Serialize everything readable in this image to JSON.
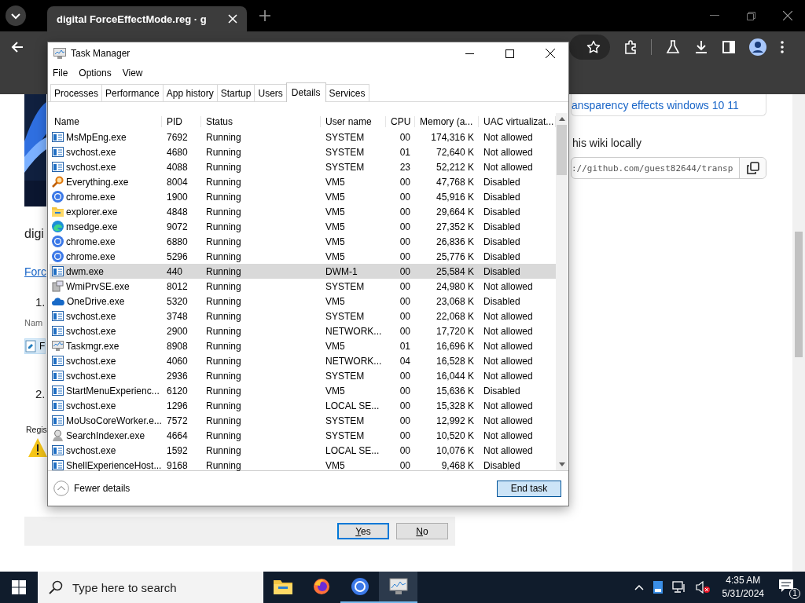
{
  "browser": {
    "tab": {
      "title": "digital ForceEffectMode.reg · g"
    }
  },
  "page": {
    "heading_fragment": "digi",
    "link_fragment": "Forc",
    "step_1": "1.",
    "name_label_fragment": "Nam",
    "file_fragment": "F",
    "step_2": "2.",
    "registry_fragment": "Regis",
    "card_link": "ansparency effects windows 10 11",
    "clone_heading": "his wiki locally",
    "clone_url": "://github.com/guest82644/transp",
    "dialog": {
      "buttons": [
        {
          "label": "Yes",
          "selected": true
        },
        {
          "label": "No",
          "selected": false
        }
      ]
    }
  },
  "task_manager": {
    "title": "Task Manager",
    "menu": [
      "File",
      "Options",
      "View"
    ],
    "tabs": [
      {
        "label": "Processes",
        "selected": false
      },
      {
        "label": "Performance",
        "selected": false
      },
      {
        "label": "App history",
        "selected": false
      },
      {
        "label": "Startup",
        "selected": false
      },
      {
        "label": "Users",
        "selected": false
      },
      {
        "label": "Details",
        "selected": true
      },
      {
        "label": "Services",
        "selected": false
      }
    ],
    "columns": [
      "Name",
      "PID",
      "Status",
      "User name",
      "CPU",
      "Memory (a...",
      "UAC virtualizat..."
    ],
    "rows": [
      {
        "kind": "service",
        "name": "MsMpEng.exe",
        "pid": "7692",
        "status": "Running",
        "user": "SYSTEM",
        "cpu": "00",
        "memory": "174,316 K",
        "uac": "Not allowed",
        "selected": false
      },
      {
        "kind": "service",
        "name": "svchost.exe",
        "pid": "4680",
        "status": "Running",
        "user": "SYSTEM",
        "cpu": "01",
        "memory": "72,640 K",
        "uac": "Not allowed",
        "selected": false
      },
      {
        "kind": "service",
        "name": "svchost.exe",
        "pid": "4088",
        "status": "Running",
        "user": "SYSTEM",
        "cpu": "23",
        "memory": "52,212 K",
        "uac": "Not allowed",
        "selected": false
      },
      {
        "kind": "search",
        "name": "Everything.exe",
        "pid": "8004",
        "status": "Running",
        "user": "VM5",
        "cpu": "00",
        "memory": "47,768 K",
        "uac": "Disabled",
        "selected": false
      },
      {
        "kind": "chrome",
        "name": "chrome.exe",
        "pid": "1900",
        "status": "Running",
        "user": "VM5",
        "cpu": "00",
        "memory": "45,916 K",
        "uac": "Disabled",
        "selected": false
      },
      {
        "kind": "folder",
        "name": "explorer.exe",
        "pid": "4848",
        "status": "Running",
        "user": "VM5",
        "cpu": "00",
        "memory": "29,664 K",
        "uac": "Disabled",
        "selected": false
      },
      {
        "kind": "edge",
        "name": "msedge.exe",
        "pid": "9072",
        "status": "Running",
        "user": "VM5",
        "cpu": "00",
        "memory": "27,352 K",
        "uac": "Disabled",
        "selected": false
      },
      {
        "kind": "chrome",
        "name": "chrome.exe",
        "pid": "6880",
        "status": "Running",
        "user": "VM5",
        "cpu": "00",
        "memory": "26,836 K",
        "uac": "Disabled",
        "selected": false
      },
      {
        "kind": "chrome",
        "name": "chrome.exe",
        "pid": "5296",
        "status": "Running",
        "user": "VM5",
        "cpu": "00",
        "memory": "25,776 K",
        "uac": "Disabled",
        "selected": false
      },
      {
        "kind": "service",
        "name": "dwm.exe",
        "pid": "440",
        "status": "Running",
        "user": "DWM-1",
        "cpu": "00",
        "memory": "25,584 K",
        "uac": "Disabled",
        "selected": true
      },
      {
        "kind": "computer",
        "name": "WmiPrvSE.exe",
        "pid": "8012",
        "status": "Running",
        "user": "SYSTEM",
        "cpu": "00",
        "memory": "24,980 K",
        "uac": "Not allowed",
        "selected": false
      },
      {
        "kind": "cloud",
        "name": "OneDrive.exe",
        "pid": "5320",
        "status": "Running",
        "user": "VM5",
        "cpu": "00",
        "memory": "23,068 K",
        "uac": "Disabled",
        "selected": false
      },
      {
        "kind": "service",
        "name": "svchost.exe",
        "pid": "3748",
        "status": "Running",
        "user": "SYSTEM",
        "cpu": "00",
        "memory": "22,068 K",
        "uac": "Not allowed",
        "selected": false
      },
      {
        "kind": "service",
        "name": "svchost.exe",
        "pid": "2900",
        "status": "Running",
        "user": "NETWORK...",
        "cpu": "00",
        "memory": "17,720 K",
        "uac": "Not allowed",
        "selected": false
      },
      {
        "kind": "monitor",
        "name": "Taskmgr.exe",
        "pid": "8908",
        "status": "Running",
        "user": "VM5",
        "cpu": "01",
        "memory": "16,696 K",
        "uac": "Not allowed",
        "selected": false
      },
      {
        "kind": "service",
        "name": "svchost.exe",
        "pid": "4060",
        "status": "Running",
        "user": "NETWORK...",
        "cpu": "04",
        "memory": "16,528 K",
        "uac": "Not allowed",
        "selected": false
      },
      {
        "kind": "service",
        "name": "svchost.exe",
        "pid": "2936",
        "status": "Running",
        "user": "SYSTEM",
        "cpu": "00",
        "memory": "16,044 K",
        "uac": "Not allowed",
        "selected": false
      },
      {
        "kind": "service",
        "name": "StartMenuExperienc...",
        "pid": "6120",
        "status": "Running",
        "user": "VM5",
        "cpu": "00",
        "memory": "15,636 K",
        "uac": "Disabled",
        "selected": false
      },
      {
        "kind": "service",
        "name": "svchost.exe",
        "pid": "1296",
        "status": "Running",
        "user": "LOCAL SE...",
        "cpu": "00",
        "memory": "15,328 K",
        "uac": "Not allowed",
        "selected": false
      },
      {
        "kind": "service",
        "name": "MoUsoCoreWorker.e...",
        "pid": "7572",
        "status": "Running",
        "user": "SYSTEM",
        "cpu": "00",
        "memory": "12,992 K",
        "uac": "Not allowed",
        "selected": false
      },
      {
        "kind": "indexer",
        "name": "SearchIndexer.exe",
        "pid": "4664",
        "status": "Running",
        "user": "SYSTEM",
        "cpu": "00",
        "memory": "10,520 K",
        "uac": "Not allowed",
        "selected": false
      },
      {
        "kind": "service",
        "name": "svchost.exe",
        "pid": "1592",
        "status": "Running",
        "user": "LOCAL SE...",
        "cpu": "00",
        "memory": "10,076 K",
        "uac": "Not allowed",
        "selected": false
      },
      {
        "kind": "service",
        "name": "ShellExperienceHost...",
        "pid": "9168",
        "status": "Running",
        "user": "VM5",
        "cpu": "00",
        "memory": "9,468 K",
        "uac": "Disabled",
        "selected": false
      }
    ],
    "footer": {
      "toggle": "Fewer details",
      "end_task": "End task"
    }
  },
  "taskbar": {
    "search_placeholder": "Type here to search",
    "apps": [
      {
        "kind": "explorer",
        "running": false,
        "active": false
      },
      {
        "kind": "firefox",
        "running": false,
        "active": false
      },
      {
        "kind": "chrome",
        "running": true,
        "active": false
      },
      {
        "kind": "taskmgr",
        "running": true,
        "active": true
      }
    ],
    "time": "4:35 AM",
    "date": "5/31/2024",
    "notifications": "1"
  }
}
